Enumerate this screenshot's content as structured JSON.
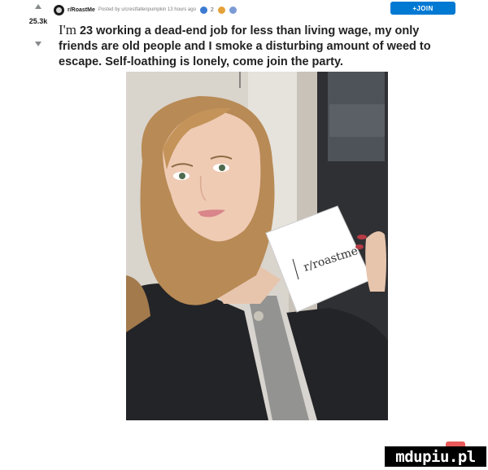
{
  "post": {
    "subreddit": "r/RoastMe",
    "posted_by": "Posted by u/crestfallenpumpkin 13 hours ago",
    "award_count": "2",
    "score": "25.3k",
    "join_label": "+JOIN",
    "title_lead": "I'm",
    "title_rest": " 23 working a dead-end job for less than living wage, my only friends are old people and I smoke a disturbing amount of weed to escape. Self-loathing is lonely, come join the party."
  },
  "photo": {
    "sign_text": "r/roastme",
    "icons": [
      "upvote-icon",
      "downvote-icon",
      "subreddit-icon",
      "award-icons"
    ]
  },
  "watermark": "mdupiu.pl"
}
